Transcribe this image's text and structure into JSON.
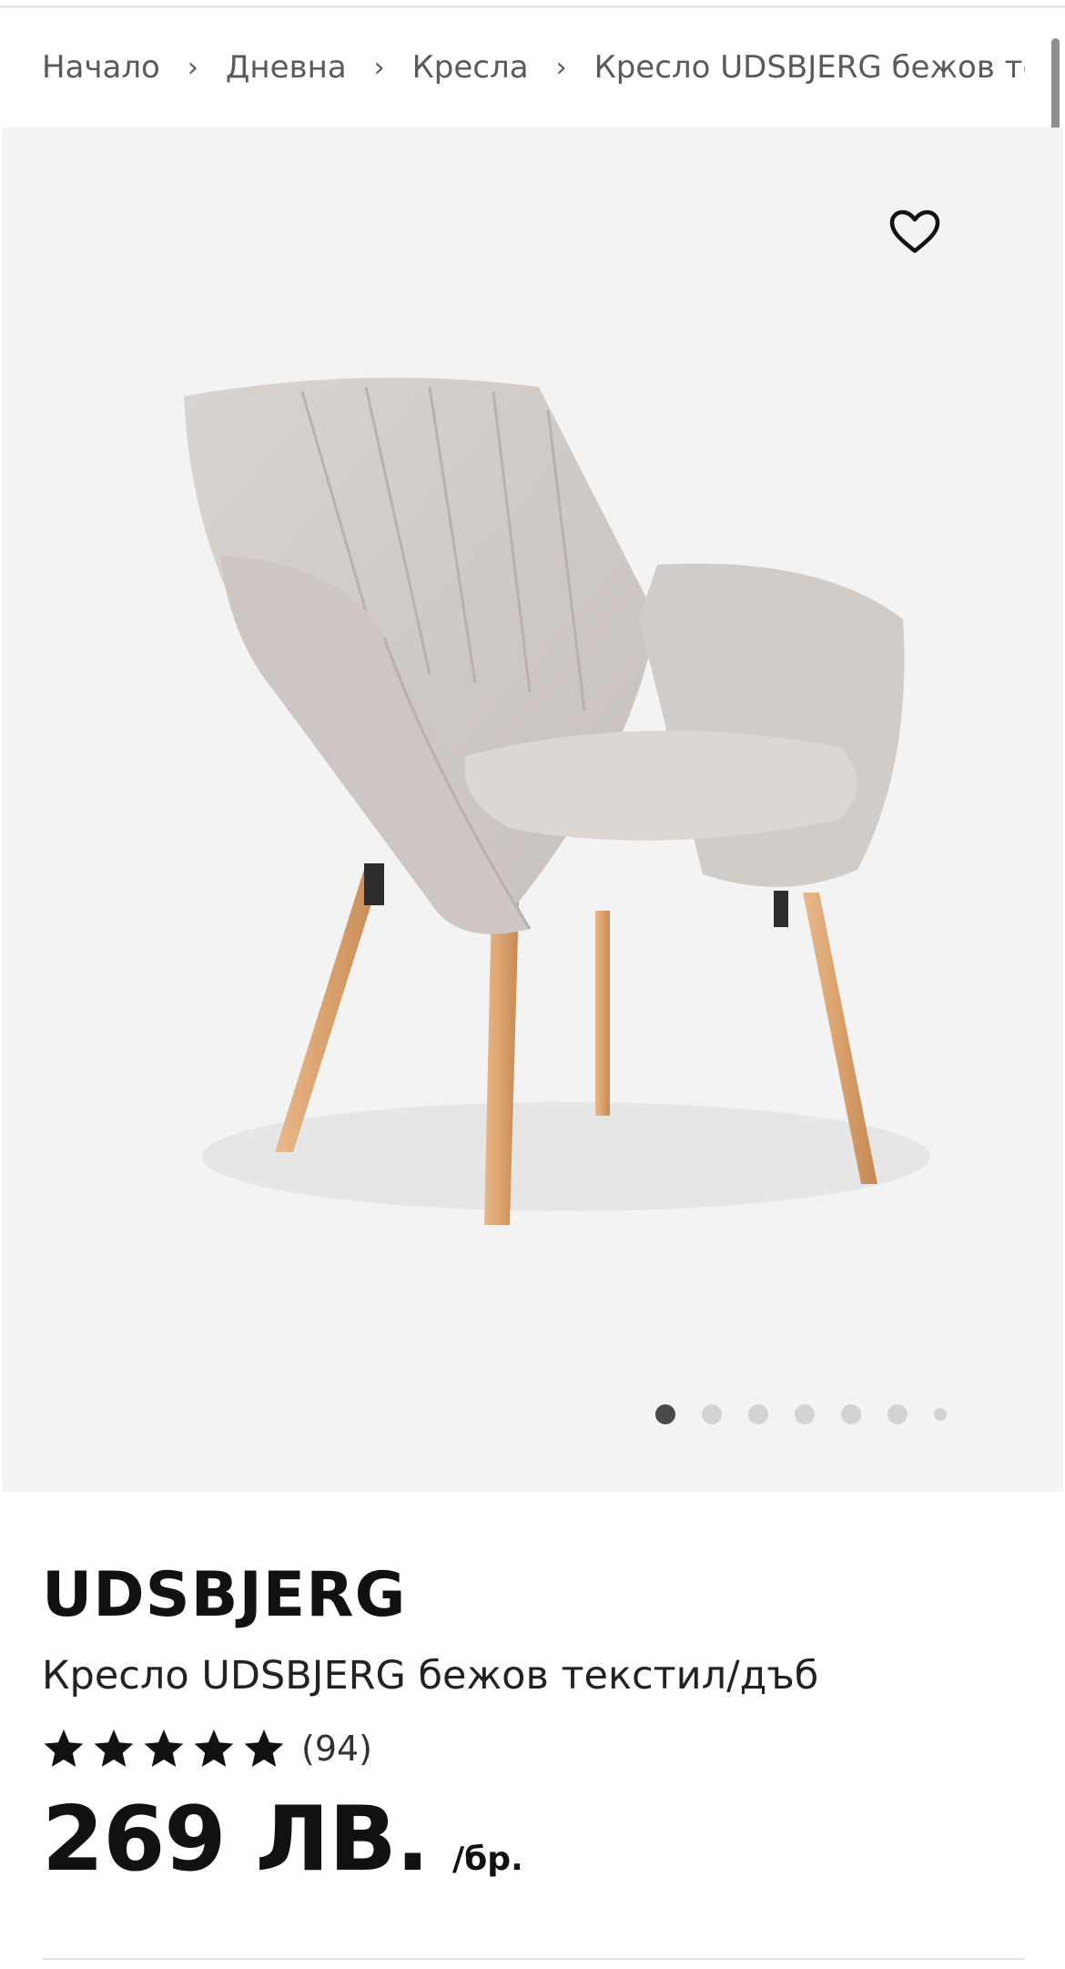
{
  "breadcrumb": {
    "items": [
      "Начало",
      "Дневна",
      "Кресла"
    ],
    "current": "Кресло UDSBJERG бежов текс"
  },
  "gallery": {
    "image_label": "Кресло UDSBJERG бежов текстил/дъб",
    "total_images": 7,
    "active_index": 1
  },
  "product": {
    "brand": "UDSBJERG",
    "name": "Кресло UDSBJERG бежов текстил/дъб",
    "rating": 5,
    "rating_count": "(94)",
    "price": "269 ЛВ.",
    "unit": "/бр."
  },
  "colors": {
    "gallery_bg": "#f3f3f3",
    "text": "#111111",
    "muted": "#5a5a5a"
  },
  "icons": [
    "chevron-right-icon",
    "heart-icon",
    "star-icon"
  ]
}
